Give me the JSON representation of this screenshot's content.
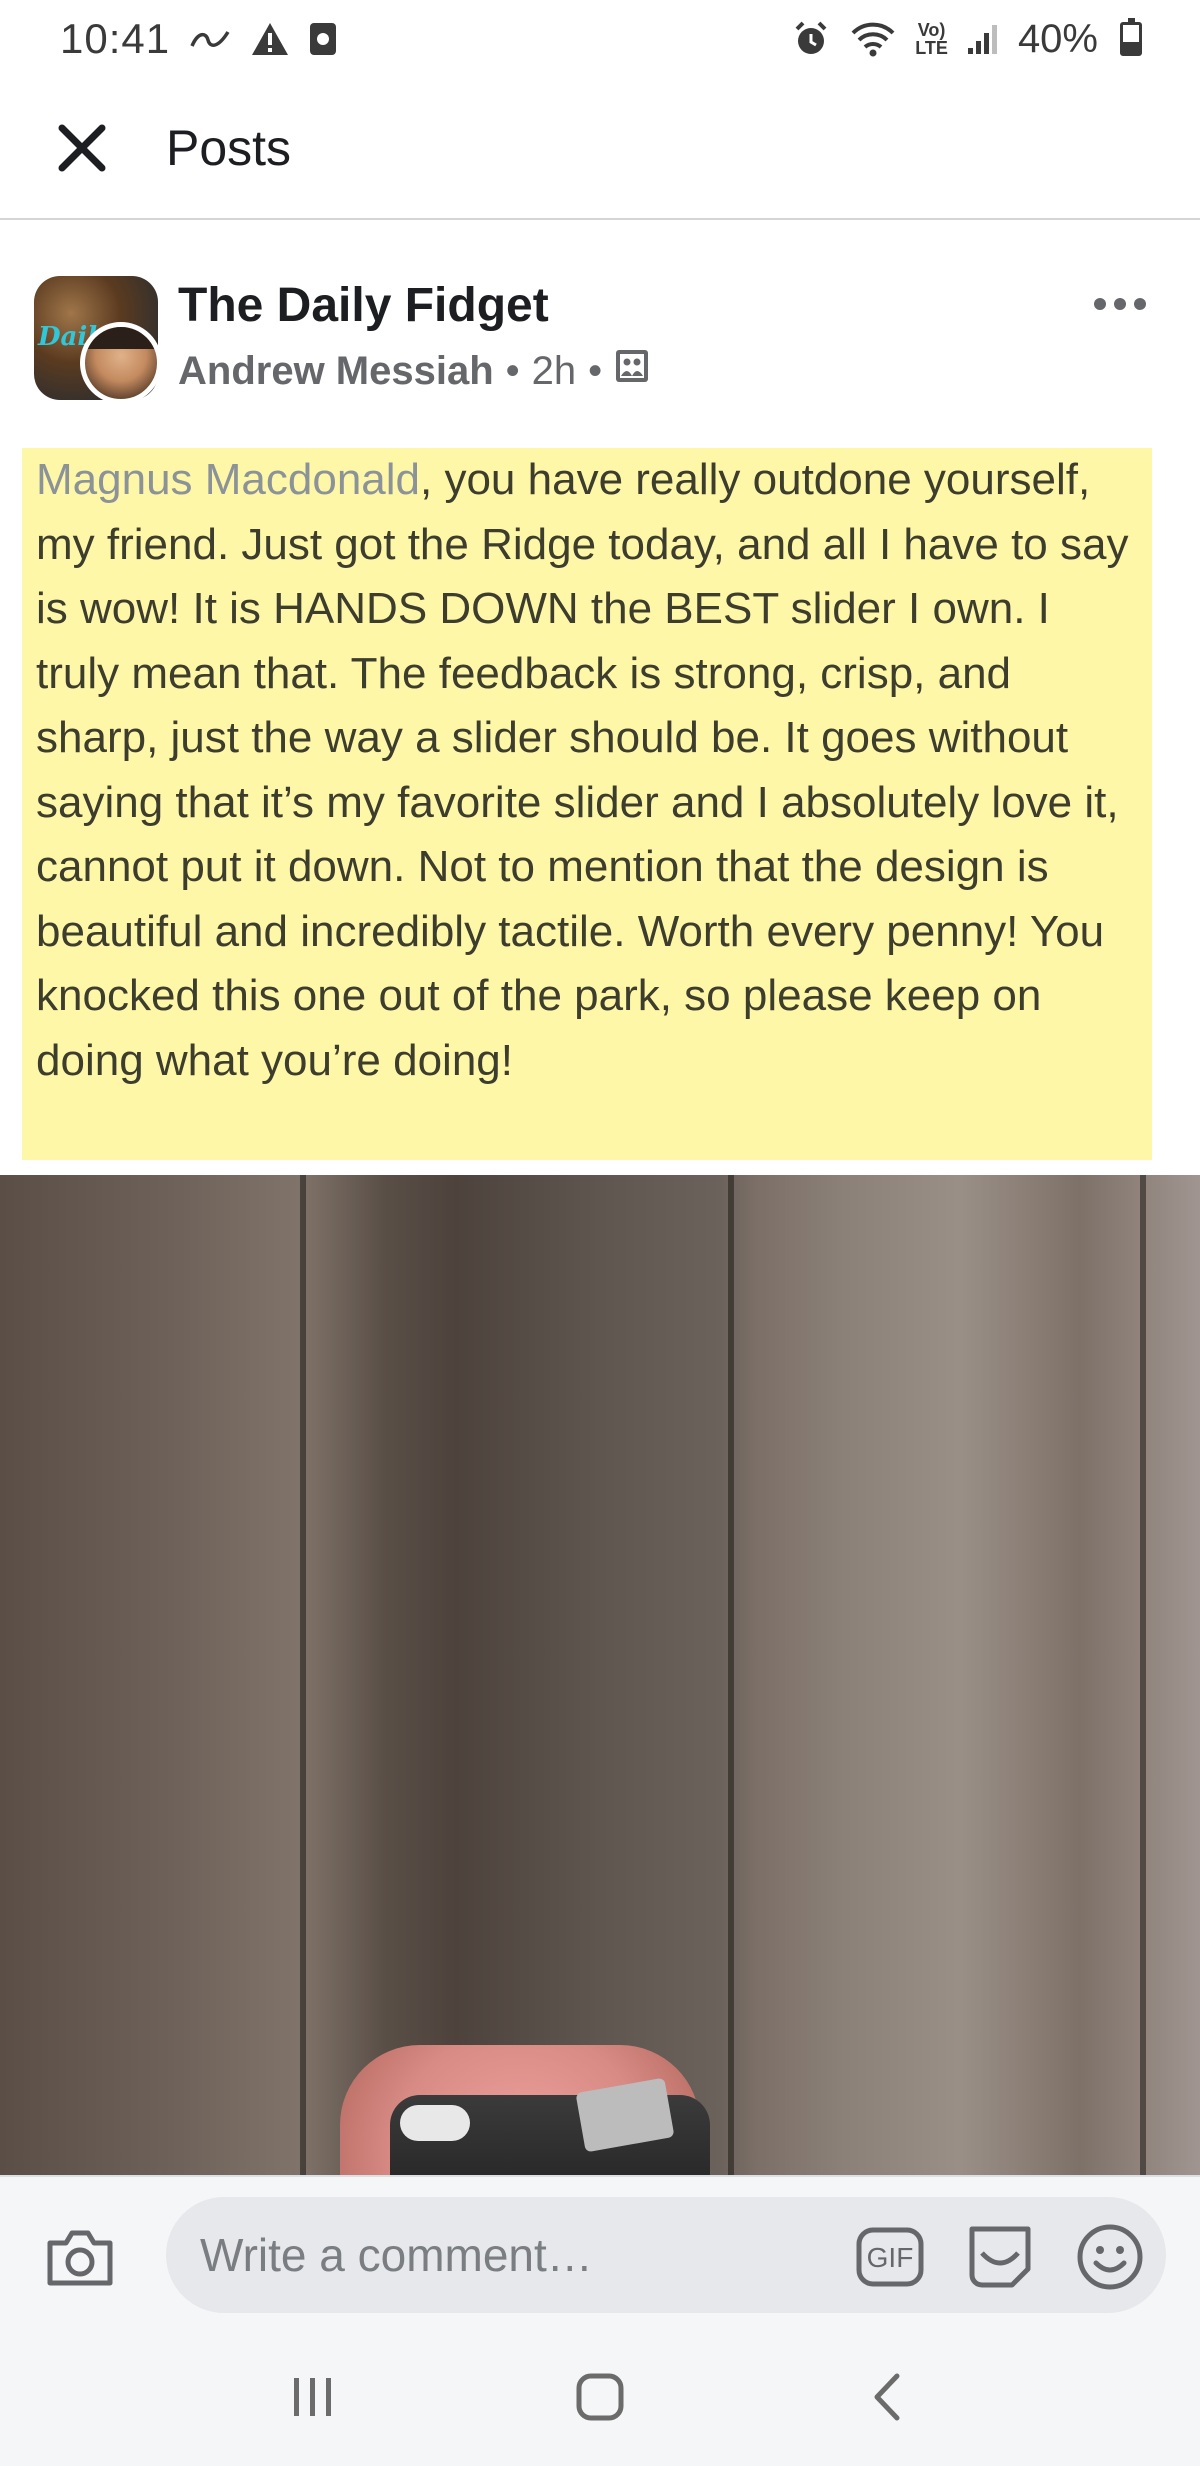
{
  "status_bar": {
    "time": "10:41",
    "left_icons": [
      "link-icon",
      "warning-icon",
      "sim-icon"
    ],
    "right_icons": [
      "alarm-icon",
      "wifi-icon",
      "volte-icon",
      "signal-icon"
    ],
    "volte_text": "Vo)\nLTE",
    "battery": "40%"
  },
  "header": {
    "title": "Posts",
    "close_icon": "close-icon"
  },
  "post": {
    "group_name": "The Daily Fidget",
    "group_avatar_text": "Dail",
    "author": "Andrew Messiah",
    "time": "2h",
    "separator": "•",
    "audience_icon": "group-photo-icon",
    "more_icon": "more-horizontal-icon",
    "mention": "Magnus Macdonald",
    "body": ", you have really outdone yourself, my friend.  Just got the Ridge today, and all I have to say is wow!  It is HANDS DOWN the BEST slider I own.  I truly mean that.  The feedback is strong, crisp, and sharp, just the way a slider should be.  It goes without saying that it’s my favorite slider and I absolutely love it, cannot put it down.  Not to mention that the design is beautiful and incredibly tactile.  Worth every penny!  You knocked this one out of the park, so please keep on doing what you’re doing!",
    "highlight_color": "#fff7a8",
    "mention_color": "#8b9399"
  },
  "comment_bar": {
    "placeholder": "Write a comment…",
    "icons": [
      "camera-icon",
      "gif-icon",
      "sticker-icon",
      "emoji-icon"
    ],
    "gif_label": "GIF"
  },
  "nav_bar": {
    "icons": [
      "recent-apps-icon",
      "home-icon",
      "back-icon"
    ]
  }
}
